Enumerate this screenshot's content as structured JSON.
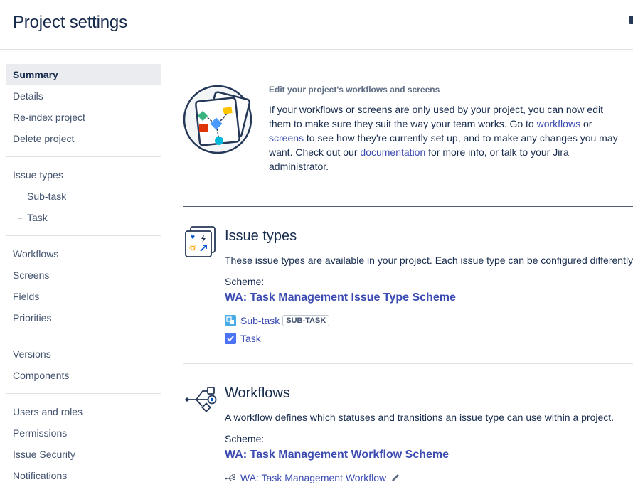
{
  "header": {
    "title": "Project settings"
  },
  "sidebar": {
    "groups": [
      {
        "items": [
          {
            "label": "Summary",
            "active": true
          },
          {
            "label": "Details"
          },
          {
            "label": "Re-index project"
          },
          {
            "label": "Delete project"
          }
        ]
      },
      {
        "items": [
          {
            "label": "Issue types"
          },
          {
            "label": "Sub-task"
          },
          {
            "label": "Task"
          }
        ]
      },
      {
        "items": [
          {
            "label": "Workflows"
          },
          {
            "label": "Screens"
          },
          {
            "label": "Fields"
          },
          {
            "label": "Priorities"
          }
        ]
      },
      {
        "items": [
          {
            "label": "Versions"
          },
          {
            "label": "Components"
          }
        ]
      },
      {
        "items": [
          {
            "label": "Users and roles"
          },
          {
            "label": "Permissions"
          },
          {
            "label": "Issue Security"
          },
          {
            "label": "Notifications"
          }
        ]
      }
    ]
  },
  "intro": {
    "heading": "Edit your project's workflows and screens",
    "text_1": "If your workflows or screens are only used by your project, you can now edit them to make sure they suit the way your team works. Go to ",
    "link_workflows": "workflows",
    "text_2": " or ",
    "link_screens": "screens",
    "text_3": " to see how they're currently set up, and to make any changes you may want. Check out our ",
    "link_documentation": "documentation",
    "text_4": " for more info, or talk to your Jira administrator."
  },
  "issue_types": {
    "title": "Issue types",
    "description": "These issue types are available in your project. Each issue type can be configured differently.",
    "scheme_label": "Scheme:",
    "scheme_name": "WA: Task Management Issue Type Scheme",
    "items": [
      {
        "label": "Sub-task",
        "badge": "SUB-TASK",
        "icon": "subtask-icon"
      },
      {
        "label": "Task",
        "badge": "",
        "icon": "task-checkbox-icon"
      }
    ]
  },
  "workflows": {
    "title": "Workflows",
    "description": "A workflow defines which statuses and transitions an issue type can use within a project.",
    "scheme_label": "Scheme:",
    "scheme_name": "WA: Task Management Workflow Scheme",
    "items": [
      {
        "label": "WA: Task Management Workflow",
        "icon": "workflow-icon",
        "action_icon": "pencil-icon"
      }
    ]
  },
  "colors": {
    "link": "#3b4bb1",
    "text": "#172b4d",
    "muted": "#42526e",
    "active_bg": "#ebecf0",
    "jira_blue": "#4c73f5"
  }
}
